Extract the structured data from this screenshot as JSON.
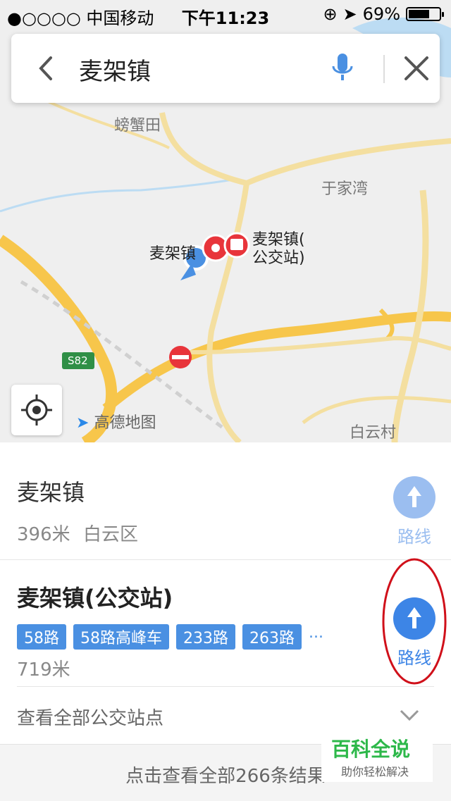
{
  "status_bar": {
    "carrier": "●○○○○ 中国移动",
    "time": "下午11:23",
    "battery": "69%",
    "battery_level": 0.69
  },
  "search": {
    "query": "麦架镇"
  },
  "map": {
    "labels": {
      "crab_field": "螃蟹田",
      "yujiawan": "于家湾",
      "maijiazhen_short": "麦架镇",
      "bus_station_line1": "麦架镇(",
      "bus_station_line2": "公交站)",
      "highway": "S82",
      "baiyuncun": "白云村",
      "logo": "高德地图"
    },
    "colors": {
      "road": "#f7c64b",
      "minor_road": "#f4dfa0",
      "water": "#bcdcf3",
      "pin": "#4a90e2",
      "poi_red": "#e8353b"
    }
  },
  "results": [
    {
      "title": "麦架镇",
      "distance": "396米",
      "district": "白云区",
      "route_label": "路线"
    },
    {
      "title": "麦架镇(公交站)",
      "bus_lines": [
        "58路",
        "58路高峰车",
        "233路",
        "263路"
      ],
      "more": "...",
      "distance": "719米",
      "route_label": "路线",
      "view_all": "查看全部公交站点"
    }
  ],
  "footer": {
    "text": "点击查看全部266条结果"
  },
  "watermark": {
    "title": "百科全说",
    "subtitle": "助你轻松解决"
  }
}
